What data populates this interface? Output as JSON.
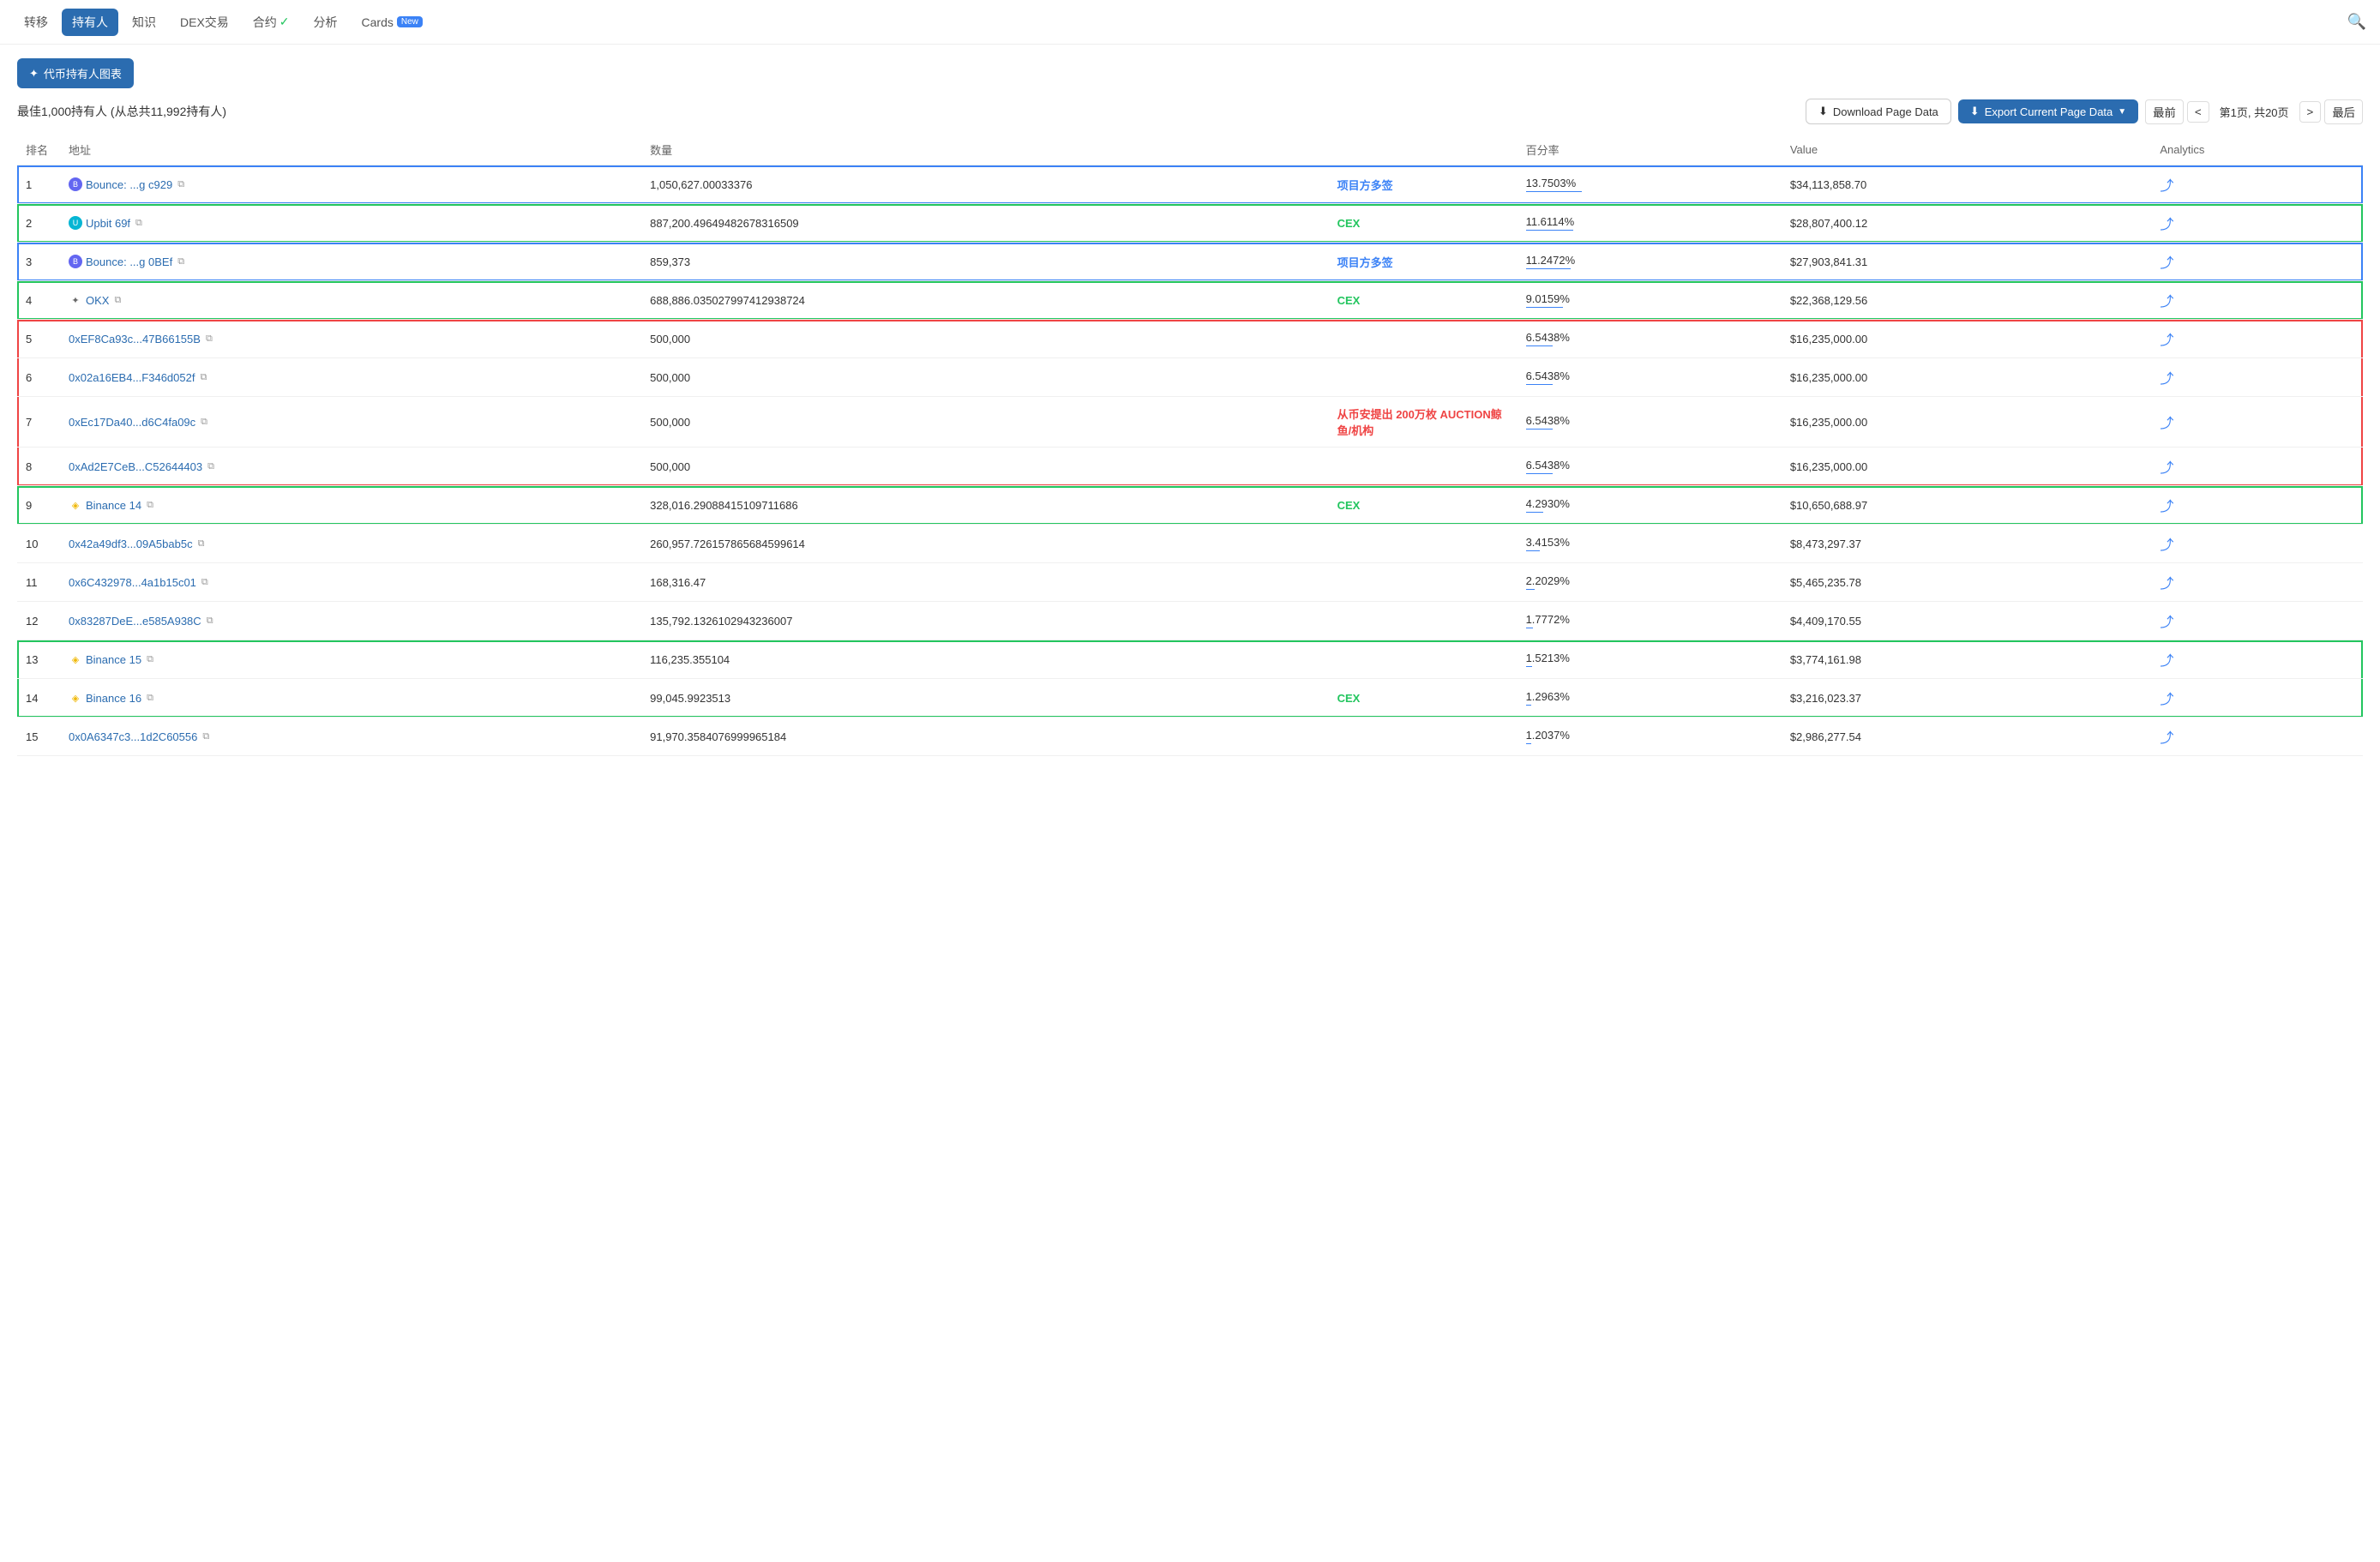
{
  "nav": {
    "items": [
      {
        "id": "transfer",
        "label": "转移",
        "active": false
      },
      {
        "id": "holders",
        "label": "持有人",
        "active": true
      },
      {
        "id": "knowledge",
        "label": "知识",
        "active": false
      },
      {
        "id": "dex",
        "label": "DEX交易",
        "active": false
      },
      {
        "id": "contract",
        "label": "合约",
        "active": false,
        "verified": true
      },
      {
        "id": "analysis",
        "label": "分析",
        "active": false
      },
      {
        "id": "cards",
        "label": "Cards",
        "active": false,
        "badge": "New"
      }
    ],
    "search_icon": "🔍"
  },
  "toolbar": {
    "chart_btn": "代币持有人图表"
  },
  "info": {
    "description": "最佳1,000持有人 (从总共11,992持有人)",
    "download_label": "Download Page Data",
    "export_label": "Export Current Page Data",
    "pagination": {
      "first": "最前",
      "prev": "<",
      "page_info": "第1页, 共20页",
      "next": ">",
      "last": "最后"
    }
  },
  "table": {
    "headers": [
      "排名",
      "地址",
      "数量",
      "",
      "百分率",
      "Value",
      "Analytics"
    ],
    "rows": [
      {
        "rank": "1",
        "addr": "Bounce: ...g c929",
        "addr_type": "bounce",
        "qty": "1,050,627.00033376",
        "pct": "13.7503%",
        "pct_width": 65,
        "value": "$34,113,858.70",
        "group": "blue",
        "position": "single",
        "label_text": "项目方多签",
        "label_color": "blue"
      },
      {
        "rank": "2",
        "addr": "Upbit 69f",
        "addr_type": "upbit",
        "qty": "887,200.49649482678316509",
        "pct": "11.6114%",
        "pct_width": 55,
        "value": "$28,807,400.12",
        "group": "green",
        "position": "single",
        "label_text": "CEX",
        "label_color": "green"
      },
      {
        "rank": "3",
        "addr": "Bounce: ...g 0BEf",
        "addr_type": "bounce",
        "qty": "859,373",
        "pct": "11.2472%",
        "pct_width": 52,
        "value": "$27,903,841.31",
        "group": "blue2",
        "position": "single",
        "label_text": "项目方多签",
        "label_color": "blue"
      },
      {
        "rank": "4",
        "addr": "OKX",
        "addr_type": "okx",
        "qty": "688,886.035027997412938724",
        "pct": "9.0159%",
        "pct_width": 43,
        "value": "$22,368,129.56",
        "group": "green2",
        "position": "single",
        "label_text": "CEX",
        "label_color": "green"
      },
      {
        "rank": "5",
        "addr": "0xEF8Ca93c...47B66155B",
        "addr_type": "plain",
        "qty": "500,000",
        "pct": "6.5438%",
        "pct_width": 31,
        "value": "$16,235,000.00",
        "group": "red",
        "position": "top"
      },
      {
        "rank": "6",
        "addr": "0x02a16EB4...F346d052f",
        "addr_type": "plain",
        "qty": "500,000",
        "pct": "6.5438%",
        "pct_width": 31,
        "value": "$16,235,000.00",
        "group": "red",
        "position": "middle"
      },
      {
        "rank": "7",
        "addr": "0xEc17Da40...d6C4fa09c",
        "addr_type": "plain",
        "qty": "500,000",
        "pct": "6.5438%",
        "pct_width": 31,
        "value": "$16,235,000.00",
        "group": "red",
        "position": "middle",
        "label_text": "从币安提出 200万枚 AUCTION鲸鱼/机构",
        "label_color": "red"
      },
      {
        "rank": "8",
        "addr": "0xAd2E7CeB...C52644403",
        "addr_type": "plain",
        "qty": "500,000",
        "pct": "6.5438%",
        "pct_width": 31,
        "value": "$16,235,000.00",
        "group": "red",
        "position": "bottom"
      },
      {
        "rank": "9",
        "addr": "Binance 14",
        "addr_type": "binance",
        "qty": "328,016.29088415109711686",
        "pct": "4.2930%",
        "pct_width": 20,
        "value": "$10,650,688.97",
        "group": "green3",
        "position": "single",
        "label_text": "CEX",
        "label_color": "green"
      },
      {
        "rank": "10",
        "addr": "0x42a49df3...09A5bab5c",
        "addr_type": "plain",
        "qty": "260,957.726157865684599614",
        "pct": "3.4153%",
        "pct_width": 16,
        "value": "$8,473,297.37",
        "group": "none",
        "position": "single"
      },
      {
        "rank": "11",
        "addr": "0x6C432978...4a1b15c01",
        "addr_type": "plain",
        "qty": "168,316.47",
        "pct": "2.2029%",
        "pct_width": 10,
        "value": "$5,465,235.78",
        "group": "none",
        "position": "single"
      },
      {
        "rank": "12",
        "addr": "0x83287DeE...e585A938C",
        "addr_type": "plain",
        "qty": "135,792.1326102943236007",
        "pct": "1.7772%",
        "pct_width": 8,
        "value": "$4,409,170.55",
        "group": "none",
        "position": "single"
      },
      {
        "rank": "13",
        "addr": "Binance 15",
        "addr_type": "binance",
        "qty": "116,235.355104",
        "pct": "1.5213%",
        "pct_width": 7,
        "value": "$3,774,161.98",
        "group": "green4",
        "position": "top"
      },
      {
        "rank": "14",
        "addr": "Binance 16",
        "addr_type": "binance",
        "qty": "99,045.9923513",
        "pct": "1.2963%",
        "pct_width": 6,
        "value": "$3,216,023.37",
        "group": "green4",
        "position": "bottom",
        "label_text": "CEX",
        "label_color": "green"
      },
      {
        "rank": "15",
        "addr": "0x0A6347c3...1d2C60556",
        "addr_type": "plain",
        "qty": "91,970.3584076999965184",
        "pct": "1.2037%",
        "pct_width": 6,
        "value": "$2,986,277.54",
        "group": "none",
        "position": "single"
      }
    ]
  }
}
